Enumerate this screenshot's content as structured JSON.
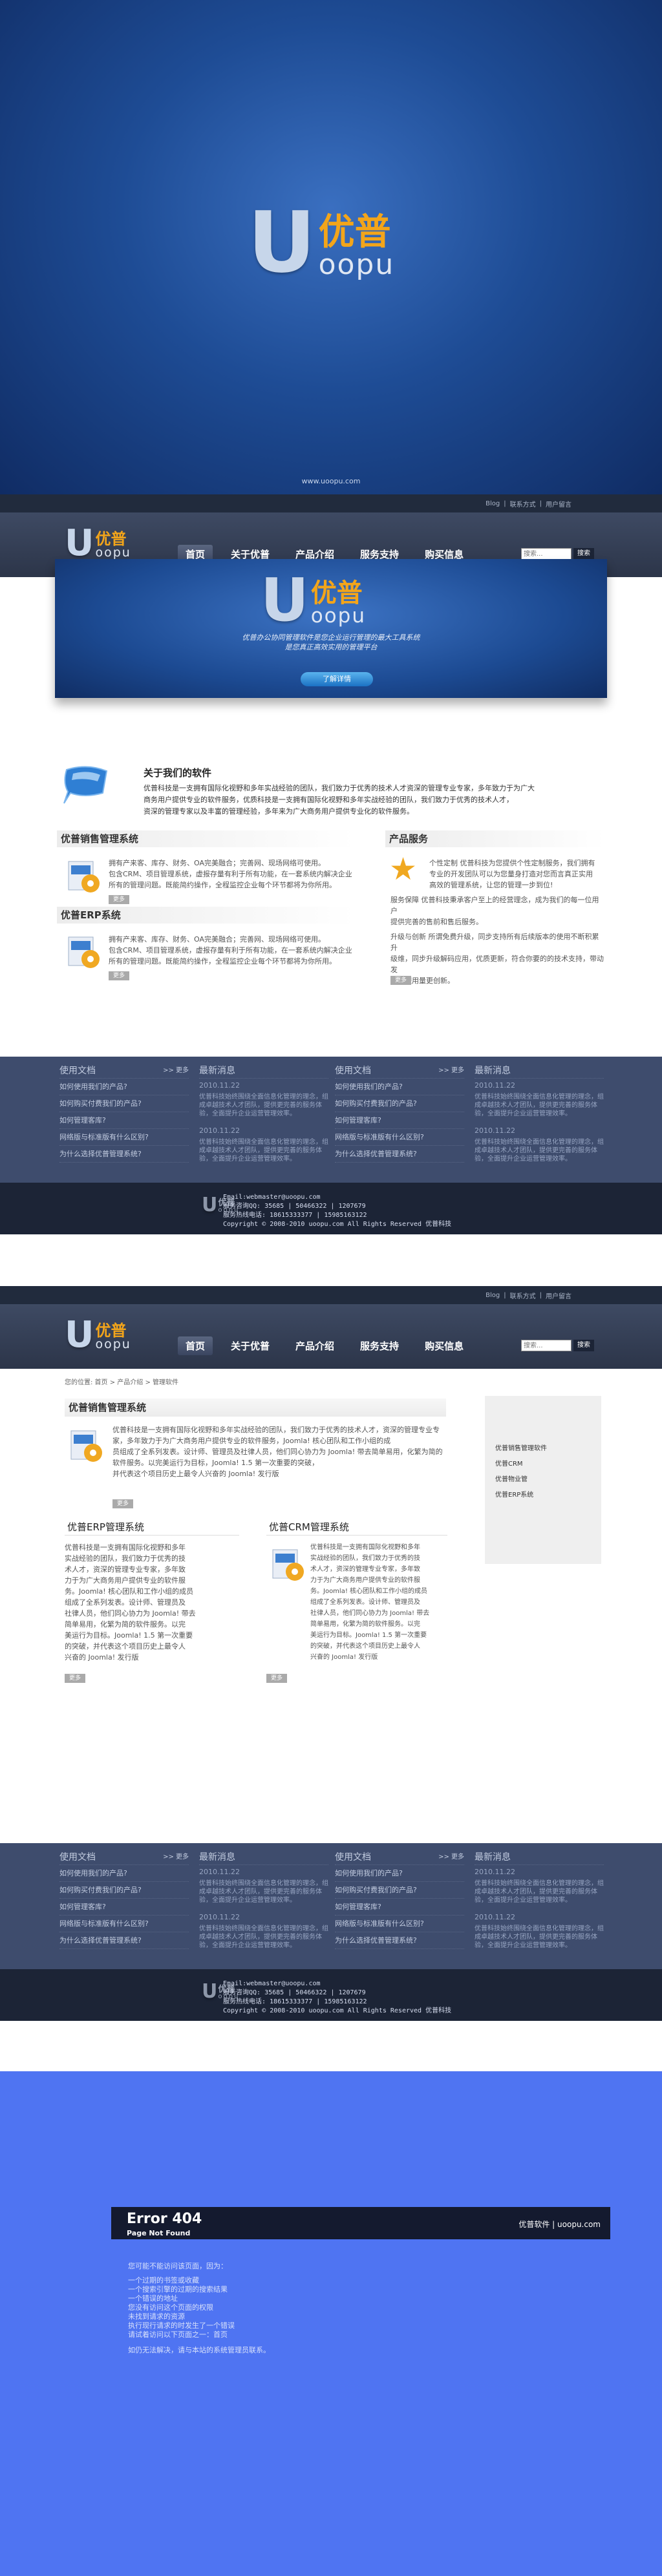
{
  "splash": {
    "logo_cn": "优普",
    "logo_en": "oopu",
    "logo_u": "U",
    "url": "www.uoopu.com"
  },
  "topbar": {
    "links": [
      "Blog",
      "联系方式",
      "用户留言"
    ],
    "sep": "|"
  },
  "nav": [
    "首页",
    "关于优普",
    "产品介绍",
    "服务支持",
    "购买信息"
  ],
  "search": {
    "placeholder": "搜索...",
    "button": "搜索"
  },
  "banner": {
    "line1": "优普办公协同管理软件是您企业运行管理的最大工具系统",
    "line2": "是您真正高效实用的管理平台",
    "button": "了解详情"
  },
  "about": {
    "title": "关于我们的软件",
    "lines": [
      "优普科技是一支拥有国际化视野和多年实战经验的团队，我们致力于优秀的技术人才资深的管理专业专家，多年致力于为广大",
      "商务用户提供专业的软件服务，优质科技是一支拥有国际化视野和多年实战经验的团队，我们致力于优秀的技术人才，",
      "资深的管理专家以及丰富的管理经验，多年来为广大商务用户提供专业化的软件服务。"
    ]
  },
  "home": {
    "sales_title": "优普销售管理系统",
    "sales_lines": [
      "拥有产来客、库存、财务、OA完美融合；完善网、现场网络可使用。",
      "包含CRM、项目管理系统，虚报存量有利于所有功能，在一套系统内解决企业",
      "所有的管理问题。既能简约操作，全程监控企业每个环节都将为你所用。"
    ],
    "erp_title": "优普ERP系统",
    "erp_lines": [
      "拥有产来客、库存、财务、OA完美融合；完善网、现场网络可使用。",
      "包含CRM、项目管理系统，虚报存量有利于所有功能，在一套系统内解决企业",
      "所有的管理问题。既能简约操作，全程监控企业每个环节都将为你所用。"
    ],
    "more": "更多",
    "service_title": "产品服务",
    "service_lines": [
      "个性定制 优普科技为您提供个性定制服务，我们拥有",
      "专业的开发团队可以为您量身打造对您而言真正实用",
      "高效的管理系统，让您的管理一步到位!",
      "",
      "服务保障 优普科技秉承客户至上的经营理念，成为我们的每一位用户",
      "提供完善的售前和售后服务。",
      "",
      "升级与创新 所谓免费升级，同步支持所有后续版本的使用不断积累升",
      "级维，同步升级解码应用，优质更新，符合你要的的技术支持，带动发",
      "展，使用量更创新。"
    ]
  },
  "footer": {
    "docs_title": "使用文档",
    "docs_more": ">> 更多",
    "docs": [
      "如何使用我们的产品?",
      "如何购买付费我们的产品?",
      "如何管理客库?",
      "网络版与标准版有什么区别?",
      "为什么选择优普管理系统?"
    ],
    "news_title": "最新消息",
    "news": [
      {
        "date": "2010.11.22",
        "text": "优普科技始终围绕全面信息化管理的理念，组成卓越技术人才团队，提供更完善的服务体验，全面提升企业运营管理效率。"
      },
      {
        "date": "2010.11.22",
        "text": "优普科技始终围绕全面信息化管理的理念，组成卓越技术人才团队，提供更完善的服务体验，全面提升企业运营管理效率。"
      }
    ]
  },
  "copyright": {
    "email": "Email:webmaster@uoopu.com",
    "phone": "服务咨询QQ: 35685 | 50466322 | 1207679",
    "tel": "服务热线电话: 18615333377 | 15985163122",
    "line": "Copyright © 2008-2010 uoopu.com All Rights Reserved 优普科技"
  },
  "product_page": {
    "breadcrumb": "您的位置: 首页 > 产品介绍 > 管理软件",
    "title": "优普销售管理系统",
    "lines": [
      "优普科技是一支拥有国际化视野和多年实战经验的团队，我们致力于优秀的技术人才，资深的管理专业专家，多年致力于为广大商务用户提供专业的软件服务，Joomla! 核心团队和工作小组的成",
      "员组成了全系列发表。设计师、管理员及社律人员，他们同心协力为 Joomla! 带去简单易用，化繁为简的软件服务。以完美运行为目标，Joomla! 1.5 第一次重要的突破，",
      "并代表这个项目历史上最令人兴奋的 Joomla! 发行版"
    ],
    "erp_title": "优普ERP管理系统",
    "erp_lines": [
      "优普科技是一支拥有国际化视野和多年",
      "实战经验的团队，我们致力于优秀的技",
      "术人才，资深的管理专业专家，多年致",
      "力于为广大商务用户提供专业的软件服",
      "务。Joomla! 核心团队和工作小组的成员",
      "组成了全系列发表。设计师、管理员及",
      "社律人员，他们同心协力为 Joomla! 带去",
      "简单易用，化繁为简的软件服务。以完",
      "美运行为目标。Joomla! 1.5 第一次重要",
      "的突破，并代表这个项目历史上最令人",
      "兴奋的 Joomla! 发行版"
    ],
    "crm_title": "优普CRM管理系统",
    "crm_lines": [
      "优普科技是一支拥有国际化视野和多年",
      "实战经验的团队，我们致力于优秀的技",
      "术人才，资深的管理专业专家，多年致",
      "力于为广大商务用户提供专业的软件服",
      "务。Joomla! 核心团队和工作小组的成员",
      "组成了全系列发表。设计师、管理员及",
      "社律人员，他们同心协力为 Joomla! 带去",
      "简单易用，化繁为简的软件服务。以完",
      "美运行为目标。Joomla! 1.5 第一次重要",
      "的突破，并代表这个项目历史上最令人",
      "兴奋的 Joomla! 发行版"
    ],
    "sidebar": [
      "优普销售管理软件",
      "优普CRM",
      "优普物业管",
      "优普ERP系统"
    ],
    "more": "更多"
  },
  "error_page": {
    "code": "Error 404",
    "sub": "Page Not Found",
    "site": "优普软件 | uoopu.com",
    "intro": "您可能不能访问该页面，因为：",
    "reasons": [
      "一个过期的书签或收藏",
      "一个搜索引擎的过期的搜索结果",
      "一个错误的地址",
      "您没有访问这个页面的权限",
      "未找到请求的资源",
      "执行现行请求的时发生了一个错误",
      "请试着访问以下页面之一：首页"
    ],
    "footer_note": "如仍无法解决，请与本站的系统管理员联系。"
  }
}
